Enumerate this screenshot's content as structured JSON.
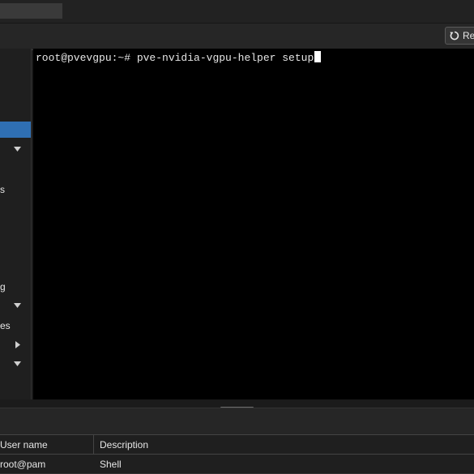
{
  "toolbar": {
    "reboot_label": "Reb"
  },
  "sidebar": {
    "items": [
      {
        "label": ""
      },
      {
        "label": ""
      },
      {
        "label": "s"
      },
      {
        "label": "g"
      },
      {
        "label": "",
        "arrow": "▼"
      },
      {
        "label": "es"
      },
      {
        "label": "",
        "arrow": "▶"
      },
      {
        "label": "",
        "arrow": "▼"
      }
    ],
    "first_arrow": "▼"
  },
  "terminal": {
    "prompt": "root@pvevgpu:~# ",
    "command": "pve-nvidia-vgpu-helper setup"
  },
  "tasks": {
    "columns": [
      "User name",
      "Description"
    ],
    "rows": [
      {
        "user": "root@pam",
        "description": "Shell"
      }
    ]
  }
}
